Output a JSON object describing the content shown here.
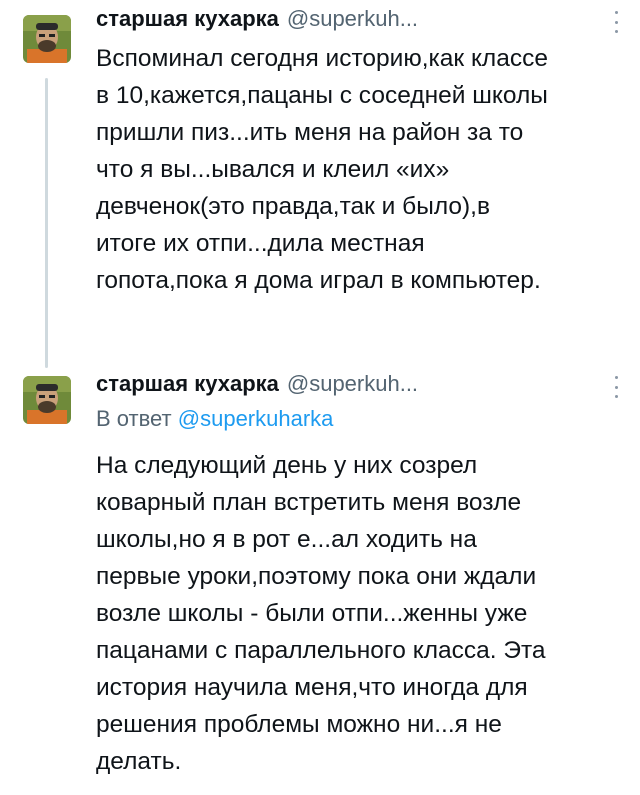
{
  "tweets": [
    {
      "name": "старшая кухарка",
      "handle": "@superkuh...",
      "lines": [
        "Вспоминал сегодня историю,как классе",
        "в 10,кажется,пацаны с соседней школы",
        "пришли пиз...ить меня на район за то",
        "что я вы...ывался и клеил «их»",
        "девченок(это правда,так и было),в",
        "итоге их отпи...дила местная",
        "гопота,пока я дома играл в компьютер."
      ]
    },
    {
      "name": "старшая кухарка",
      "handle": "@superkuh...",
      "reply_prefix": "В ответ",
      "reply_mention": "@superkuharka",
      "lines": [
        "На следующий день у них созрел",
        "коварный план встретить меня возле",
        "школы,но я в рот е...ал ходить на",
        "первые уроки,поэтому пока они ждали",
        "возле школы - были отпи...женны уже",
        "пацанами с параллельного класса. Эта",
        "история научила меня,что иногда для",
        "решения проблемы можно ни...я не",
        "делать."
      ]
    }
  ],
  "icons": {
    "avatar": "avatar-image",
    "more": "more-options-icon"
  },
  "colors": {
    "text": "#0f1419",
    "muted": "#536471",
    "link": "#1d9bf0",
    "thread_line": "#cfd9de"
  }
}
